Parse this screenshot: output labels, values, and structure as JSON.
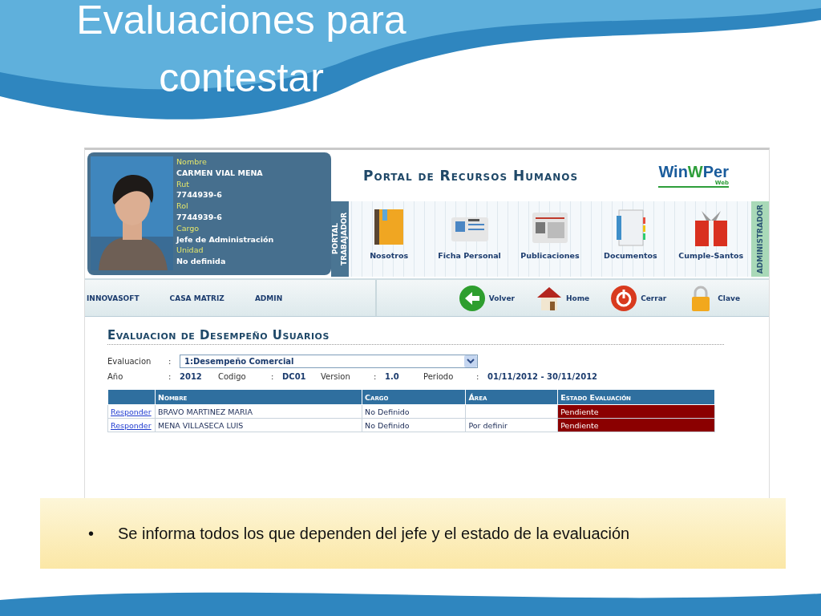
{
  "slide": {
    "title_lines": [
      "Evaluaciones para",
      "contestar"
    ],
    "bullet_marker": "•",
    "bullet": "Se informa todos los que dependen del jefe y el estado de la evaluación"
  },
  "profile": {
    "fields": [
      {
        "label": "Nombre",
        "value": "CARMEN VIAL MENA"
      },
      {
        "label": "Rut",
        "value": "7744939-6"
      },
      {
        "label": "Rol",
        "value": "7744939-6"
      },
      {
        "label": "Cargo",
        "value": "Jefe de Administración"
      },
      {
        "label": "Unidad",
        "value": "No definida"
      }
    ]
  },
  "portal": {
    "title": "Portal de Recursos Humanos",
    "logo_parts": [
      {
        "text": "Win",
        "color": "#1a5c9c"
      },
      {
        "text": "W",
        "color": "#2e9e3a"
      },
      {
        "text": "Per",
        "color": "#1a5c9c"
      }
    ],
    "logo_sub": "Web",
    "left_tab": "PORTAL TRABAJADOR",
    "right_tab": "ADMINISTRADOR",
    "modules": [
      {
        "kind": "book",
        "label": "Nosotros"
      },
      {
        "kind": "card",
        "label": "Ficha Personal"
      },
      {
        "kind": "news",
        "label": "Publicaciones"
      },
      {
        "kind": "notebook",
        "label": "Documentos"
      },
      {
        "kind": "gift",
        "label": "Cumple-Santos"
      }
    ]
  },
  "nav": {
    "links": [
      "INNOVASOFT",
      "CASA MATRIZ",
      "ADMIN"
    ],
    "actions": [
      {
        "kind": "back",
        "label": "Volver"
      },
      {
        "kind": "home",
        "label": "Home"
      },
      {
        "kind": "power",
        "label": "Cerrar"
      },
      {
        "kind": "lock",
        "label": "Clave"
      }
    ]
  },
  "section": {
    "title": "Evaluacion de Desempeño Usuarios",
    "evaluacion": {
      "label": "Evaluacion",
      "separator": ":",
      "value": "1:Desempeño Comercial"
    },
    "info": [
      {
        "label": "Año",
        "value": "2012"
      },
      {
        "label": "Codigo",
        "value": "DC01"
      },
      {
        "label": "Version",
        "value": "1.0"
      },
      {
        "label": "Periodo",
        "value": "01/11/2012 - 30/11/2012"
      }
    ]
  },
  "table": {
    "columns": [
      "Nombre",
      "Cargo",
      "Área",
      "Estado Evaluación"
    ],
    "rows": [
      {
        "action": "Responder",
        "nombre": "BRAVO MARTINEZ MARIA",
        "cargo": "No Definido",
        "estado": "Pendiente"
      },
      {
        "action": "Responder",
        "nombre": "MENA VILLASECA LUIS",
        "cargo": "No Definido",
        "area": "Por definir",
        "estado": "Pendiente"
      }
    ]
  }
}
